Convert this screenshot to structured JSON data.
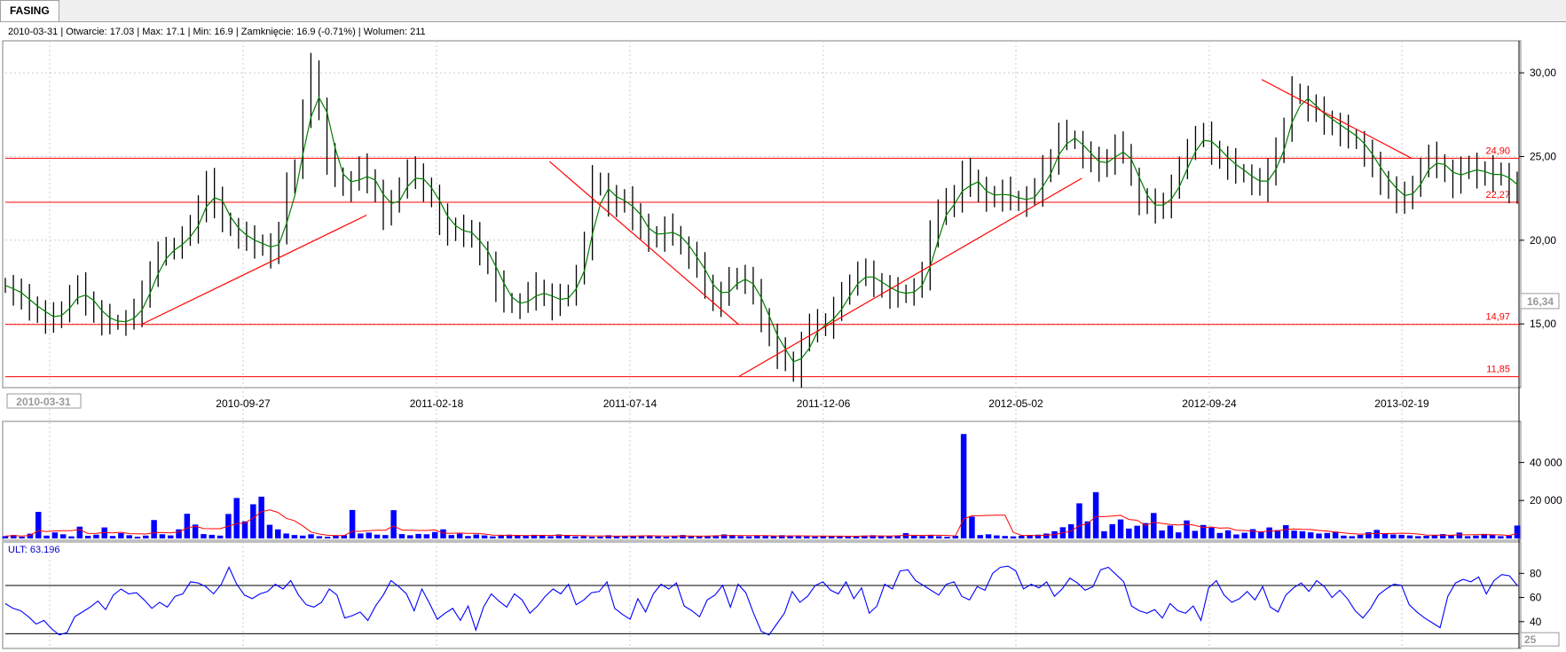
{
  "tab": {
    "label": "FASING"
  },
  "info": {
    "date": "2010-03-31",
    "open_label": "Otwarcie",
    "open": "17.03",
    "max_label": "Max",
    "max": "17.1",
    "min_label": "Min",
    "min": "16.9",
    "close_label": "Zamknięcie",
    "close": "16.9 (-0.71%)",
    "volume_label": "Wolumen",
    "volume": "211",
    "text": "2010-03-31 | Otwarcie: 17.03 | Max: 17.1 | Min: 16.9 | Zamknięcie: 16.9 (-0.71%)  | Wolumen: 211"
  },
  "ult": {
    "label": "ULT: 63.196",
    "value": 63.196,
    "levels": [
      30,
      70
    ]
  },
  "colors": {
    "price": "#000000",
    "ma": "#008000",
    "support_lines": "#ff0000",
    "volume_bars": "#0000ff",
    "volume_ma": "#ff0000",
    "ult_line": "#0000ff",
    "grid": "#cccccc"
  },
  "chart_data": [
    {
      "type": "line",
      "name": "price",
      "x_ticks": [
        "2010-09-27",
        "2011-02-18",
        "2011-07-14",
        "2011-12-06",
        "2012-05-02",
        "2012-09-24",
        "2013-02-19"
      ],
      "x_start_label": "2010-03-31",
      "y_ticks": [
        "15,00",
        "20,00",
        "25,00",
        "30,00"
      ],
      "ylim": [
        11.3,
        31.7
      ],
      "last_value_label": "16,34",
      "horizontal_levels": [
        {
          "value": 24.9,
          "label": "24,90"
        },
        {
          "value": 22.27,
          "label": "22,27"
        },
        {
          "value": 14.97,
          "label": "14,97"
        },
        {
          "value": 11.85,
          "label": "11,85"
        }
      ],
      "series": [
        {
          "values": [
            17.3,
            16.9,
            16.4,
            16.1,
            15.7,
            15.4,
            15.2,
            15.9,
            16.7,
            17.1,
            16.4,
            15.7,
            15.3,
            15.1,
            15.1,
            15.2,
            15.7,
            16.6,
            18.2,
            19.2,
            19.3,
            19.7,
            20.2,
            20.7,
            21.7,
            23.6,
            22.3,
            21.2,
            20.7,
            20.3,
            19.9,
            19.8,
            19.7,
            19.3,
            20.2,
            23.6,
            24.2,
            27.6,
            30.2,
            27.8,
            24.9,
            23.9,
            23.1,
            23.5,
            24.2,
            23.7,
            22.9,
            21.6,
            22.1,
            23.3,
            24.2,
            23.6,
            23.2,
            22.6,
            21.3,
            20.4,
            20.9,
            20.4,
            20.1,
            19.4,
            18.6,
            17.3,
            16.4,
            16.1,
            16.2,
            16.7,
            17.1,
            16.7,
            16.2,
            16.5,
            16.9,
            17.9,
            19.7,
            23.5,
            23.3,
            22.4,
            22.1,
            22.6,
            21.4,
            20.6,
            20.2,
            20.3,
            20.7,
            20.4,
            19.6,
            19.1,
            18.3,
            17.4,
            16.4,
            16.8,
            17.5,
            17.9,
            17.6,
            16.7,
            15.4,
            14.3,
            13.3,
            12.9,
            12.0,
            13.9,
            14.8,
            14.9,
            15.1,
            15.9,
            16.6,
            17.5,
            18.1,
            17.8,
            17.5,
            17.2,
            16.9,
            16.7,
            16.9,
            17.1,
            17.9,
            20.2,
            21.9,
            22.4,
            22.1,
            24.3,
            23.4,
            22.8,
            22.6,
            22.7,
            22.9,
            22.5,
            22.2,
            22.6,
            22.9,
            24.1,
            24.9,
            26.3,
            26.1,
            25.9,
            25.1,
            24.6,
            24.4,
            24.9,
            25.6,
            25.3,
            23.7,
            22.3,
            22.1,
            21.9,
            22.3,
            23.2,
            24.1,
            25.6,
            26.2,
            26.1,
            25.4,
            24.9,
            24.6,
            24.1,
            23.9,
            23.5,
            23.2,
            23.9,
            25.6,
            26.6,
            28.9,
            28.6,
            27.9,
            27.6,
            27.2,
            26.9,
            26.6,
            26.2,
            25.9,
            25.2,
            24.3,
            23.6,
            23.1,
            22.6,
            22.3,
            23.4,
            24.3,
            24.9,
            24.6,
            24.1,
            23.5,
            24.1,
            24.6,
            23.9,
            23.8,
            24.1,
            23.9,
            23.2,
            22.9
          ]
        },
        {
          "name": "trendlines",
          "lines": [
            {
              "from": {
                "x": 0.09,
                "y": 14.97
              },
              "to": {
                "x": 0.239,
                "y": 21.5
              }
            },
            {
              "from": {
                "x": 0.36,
                "y": 24.7
              },
              "to": {
                "x": 0.485,
                "y": 14.97
              }
            },
            {
              "from": {
                "x": 0.485,
                "y": 11.85
              },
              "to": {
                "x": 0.712,
                "y": 23.7
              }
            },
            {
              "from": {
                "x": 0.831,
                "y": 29.6
              },
              "to": {
                "x": 0.93,
                "y": 24.9
              }
            }
          ]
        }
      ]
    },
    {
      "type": "bar",
      "name": "volume",
      "y_ticks": [
        "20 000",
        "40 000"
      ],
      "ylim": [
        0,
        57000
      ],
      "values": [
        1200,
        1800,
        900,
        2500,
        14000,
        1500,
        3200,
        2200,
        1100,
        6200,
        1400,
        2000,
        5800,
        1300,
        2800,
        1700,
        900,
        1500,
        9700,
        2200,
        1600,
        4800,
        13000,
        7300,
        2300,
        1900,
        1500,
        12900,
        21300,
        9000,
        18000,
        22000,
        7200,
        4800,
        2600,
        1800,
        1500,
        2200,
        1200,
        900,
        1400,
        1700,
        15000,
        2600,
        3100,
        2000,
        1800,
        14900,
        2300,
        1700,
        2400,
        2200,
        3400,
        4800,
        1800,
        2500,
        1300,
        2100,
        1600,
        1100,
        1500,
        2000,
        1400,
        1600,
        1900,
        1500,
        1200,
        2100,
        1600,
        1100,
        1300,
        900,
        1000,
        1700,
        1400,
        1200,
        1300,
        1500,
        1600,
        1100,
        900,
        1200,
        1800,
        1300,
        1100,
        1400,
        1600,
        2100,
        1800,
        1200,
        1100,
        1400,
        1300,
        1200,
        1700,
        1500,
        1300,
        1100,
        1000,
        1200,
        1300,
        1400,
        900,
        1200,
        1500,
        1700,
        1300,
        1200,
        1600,
        2800,
        1400,
        1300,
        1900,
        1200,
        900,
        1400,
        55000,
        11500,
        1800,
        2200,
        1600,
        1300,
        1100,
        1400,
        1800,
        2000,
        2600,
        3800,
        5900,
        7500,
        18500,
        9000,
        24400,
        3800,
        7500,
        10000,
        5200,
        6700,
        8100,
        13400,
        4200,
        6800,
        3200,
        9500,
        4000,
        7100,
        5700,
        2900,
        4300,
        2100,
        3000,
        4900,
        3500,
        5800,
        4400,
        7000,
        4100,
        3800,
        3200,
        2600,
        2900,
        3600,
        1500,
        1200,
        1900,
        3300,
        4500,
        2800,
        2100,
        1900,
        1600,
        1200,
        1400,
        1900,
        2300,
        1700,
        3100,
        1200,
        1500,
        2400,
        1800,
        1200,
        1500,
        6800
      ]
    },
    {
      "type": "line",
      "name": "ULT",
      "y_ticks": [
        "40",
        "60",
        "80"
      ],
      "ylim": [
        20,
        92
      ],
      "last_value_label": "25",
      "values": [
        55,
        51,
        49,
        44,
        38,
        41,
        34,
        29,
        31,
        44,
        48,
        52,
        57,
        50,
        62,
        67,
        63,
        64,
        58,
        51,
        56,
        52,
        61,
        63,
        73,
        72,
        69,
        63,
        71,
        85,
        71,
        62,
        59,
        63,
        65,
        71,
        67,
        74,
        62,
        54,
        52,
        56,
        67,
        62,
        43,
        45,
        48,
        41,
        53,
        62,
        74,
        69,
        63,
        49,
        67,
        55,
        42,
        47,
        51,
        41,
        53,
        33,
        52,
        63,
        57,
        52,
        63,
        58,
        47,
        53,
        61,
        67,
        63,
        71,
        54,
        58,
        64,
        65,
        73,
        51,
        46,
        42,
        59,
        48,
        63,
        71,
        67,
        72,
        53,
        49,
        44,
        58,
        62,
        70,
        52,
        71,
        64,
        47,
        32,
        29,
        38,
        47,
        65,
        56,
        61,
        70,
        73,
        66,
        63,
        73,
        59,
        68,
        47,
        53,
        71,
        67,
        82,
        83,
        74,
        70,
        66,
        62,
        71,
        73,
        61,
        58,
        69,
        66,
        80,
        85,
        86,
        82,
        67,
        71,
        68,
        73,
        61,
        67,
        76,
        72,
        66,
        69,
        83,
        85,
        79,
        73,
        53,
        49,
        47,
        50,
        43,
        55,
        49,
        47,
        53,
        41,
        68,
        74,
        62,
        56,
        59,
        65,
        58,
        69,
        52,
        48,
        62,
        68,
        72,
        65,
        74,
        69,
        60,
        66,
        59,
        49,
        43,
        51,
        62,
        67,
        71,
        70,
        54,
        48,
        43,
        39,
        35,
        61,
        72,
        75,
        73,
        77,
        63,
        74,
        79,
        78,
        70
      ]
    }
  ]
}
